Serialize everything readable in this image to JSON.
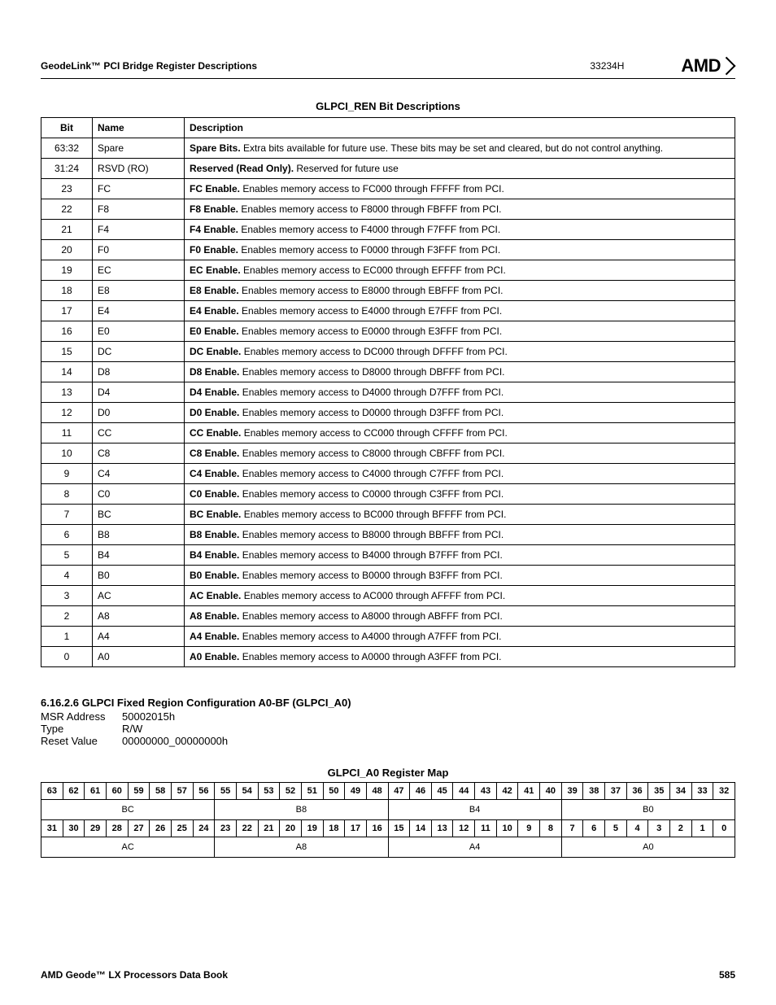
{
  "header": {
    "left": "GeodeLink™ PCI Bridge Register Descriptions",
    "mid": "33234H",
    "brand": "AMD"
  },
  "tableTitle": "GLPCI_REN Bit Descriptions",
  "cols": {
    "bit": "Bit",
    "name": "Name",
    "desc": "Description"
  },
  "rows": [
    {
      "bit": "63:32",
      "name": "Spare",
      "strong": "Spare Bits.",
      "rest": " Extra bits available for future use. These bits may be set and cleared, but do not control anything."
    },
    {
      "bit": "31:24",
      "name": "RSVD (RO)",
      "strong": "Reserved (Read Only).",
      "rest": " Reserved for future use"
    },
    {
      "bit": "23",
      "name": "FC",
      "strong": "FC Enable.",
      "rest": " Enables memory access to FC000 through FFFFF from PCI."
    },
    {
      "bit": "22",
      "name": "F8",
      "strong": "F8 Enable.",
      "rest": " Enables memory access to F8000 through FBFFF from PCI."
    },
    {
      "bit": "21",
      "name": "F4",
      "strong": "F4 Enable.",
      "rest": " Enables memory access to F4000 through F7FFF from PCI."
    },
    {
      "bit": "20",
      "name": "F0",
      "strong": "F0 Enable.",
      "rest": " Enables memory access to F0000 through F3FFF from PCI."
    },
    {
      "bit": "19",
      "name": "EC",
      "strong": "EC Enable.",
      "rest": " Enables memory access to EC000 through EFFFF from PCI."
    },
    {
      "bit": "18",
      "name": "E8",
      "strong": "E8 Enable.",
      "rest": " Enables memory access to E8000 through EBFFF from PCI."
    },
    {
      "bit": "17",
      "name": "E4",
      "strong": "E4 Enable.",
      "rest": " Enables memory access to E4000 through E7FFF from PCI."
    },
    {
      "bit": "16",
      "name": "E0",
      "strong": "E0 Enable.",
      "rest": " Enables memory access to E0000 through E3FFF from PCI."
    },
    {
      "bit": "15",
      "name": "DC",
      "strong": "DC Enable.",
      "rest": " Enables memory access to DC000 through DFFFF from PCI."
    },
    {
      "bit": "14",
      "name": "D8",
      "strong": "D8 Enable.",
      "rest": " Enables memory access to D8000 through DBFFF from PCI."
    },
    {
      "bit": "13",
      "name": "D4",
      "strong": "D4 Enable.",
      "rest": " Enables memory access to D4000 through D7FFF from PCI."
    },
    {
      "bit": "12",
      "name": "D0",
      "strong": "D0 Enable.",
      "rest": " Enables memory access to D0000 through D3FFF from PCI."
    },
    {
      "bit": "11",
      "name": "CC",
      "strong": "CC Enable.",
      "rest": " Enables memory access to CC000 through CFFFF from PCI."
    },
    {
      "bit": "10",
      "name": "C8",
      "strong": "C8 Enable.",
      "rest": " Enables memory access to C8000 through CBFFF from PCI."
    },
    {
      "bit": "9",
      "name": "C4",
      "strong": "C4 Enable.",
      "rest": " Enables memory access to C4000 through C7FFF from PCI."
    },
    {
      "bit": "8",
      "name": "C0",
      "strong": "C0 Enable.",
      "rest": " Enables memory access to C0000 through C3FFF from PCI."
    },
    {
      "bit": "7",
      "name": "BC",
      "strong": "BC Enable.",
      "rest": " Enables memory access to BC000 through BFFFF from PCI."
    },
    {
      "bit": "6",
      "name": "B8",
      "strong": "B8 Enable.",
      "rest": " Enables memory access to B8000 through BBFFF from PCI."
    },
    {
      "bit": "5",
      "name": "B4",
      "strong": "B4 Enable.",
      "rest": " Enables memory access to B4000 through B7FFF from PCI."
    },
    {
      "bit": "4",
      "name": "B0",
      "strong": "B0 Enable.",
      "rest": " Enables memory access to B0000 through B3FFF from PCI."
    },
    {
      "bit": "3",
      "name": "AC",
      "strong": "AC Enable.",
      "rest": " Enables memory access to AC000 through AFFFF from PCI."
    },
    {
      "bit": "2",
      "name": "A8",
      "strong": "A8 Enable.",
      "rest": " Enables memory access to A8000 through ABFFF from PCI."
    },
    {
      "bit": "1",
      "name": "A4",
      "strong": "A4 Enable.",
      "rest": " Enables memory access to A4000 through A7FFF from PCI."
    },
    {
      "bit": "0",
      "name": "A0",
      "strong": "A0 Enable.",
      "rest": " Enables memory access to A0000 through A3FFF from PCI."
    }
  ],
  "section2": {
    "heading": "6.16.2.6   GLPCI Fixed Region Configuration A0-BF (GLPCI_A0)",
    "kv": [
      {
        "label": "MSR Address",
        "value": "50002015h"
      },
      {
        "label": "Type",
        "value": "R/W"
      },
      {
        "label": "Reset Value",
        "value": "00000000_00000000h"
      }
    ],
    "mapTitle": "GLPCI_A0 Register Map",
    "bitsHigh": [
      "63",
      "62",
      "61",
      "60",
      "59",
      "58",
      "57",
      "56",
      "55",
      "54",
      "53",
      "52",
      "51",
      "50",
      "49",
      "48",
      "47",
      "46",
      "45",
      "44",
      "43",
      "42",
      "41",
      "40",
      "39",
      "38",
      "37",
      "36",
      "35",
      "34",
      "33",
      "32"
    ],
    "namesHigh": [
      "BC",
      "B8",
      "B4",
      "B0"
    ],
    "bitsLow": [
      "31",
      "30",
      "29",
      "28",
      "27",
      "26",
      "25",
      "24",
      "23",
      "22",
      "21",
      "20",
      "19",
      "18",
      "17",
      "16",
      "15",
      "14",
      "13",
      "12",
      "11",
      "10",
      "9",
      "8",
      "7",
      "6",
      "5",
      "4",
      "3",
      "2",
      "1",
      "0"
    ],
    "namesLow": [
      "AC",
      "A8",
      "A4",
      "A0"
    ]
  },
  "footer": {
    "left": "AMD Geode™ LX Processors Data Book",
    "right": "585"
  }
}
